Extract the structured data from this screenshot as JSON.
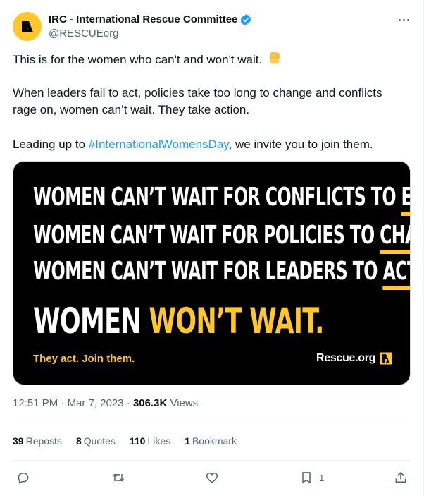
{
  "account": {
    "display_name": "IRC - International Rescue Committee",
    "handle": "@RESCUEorg",
    "verified": true,
    "avatar_color": "#ffc72c"
  },
  "tweet": {
    "line1": "This is for the women who can't and won't wait.",
    "line1_emoji": "raised-fist-emoji",
    "paragraph2": "When leaders fail to act, policies take too long to change and conflicts rage on, women can’t wait. They take action.",
    "line3_before": "Leading up to ",
    "hashtag": "#InternationalWomensDay",
    "line3_after": ", we invite you to join them."
  },
  "media": {
    "line1_main": "WOMEN CAN’T WAIT FOR CONFLICTS TO ",
    "line1_underlined": "END.",
    "line2_main": "WOMEN CAN’T WAIT FOR POLICIES TO ",
    "line2_underlined": "CHANGE.",
    "line3_main": "WOMEN CAN’T WAIT FOR LEADERS TO ",
    "line3_underlined": "ACT.",
    "big_white": "WOMEN ",
    "big_yellow": "WON’T WAIT.",
    "tagline": "They act. Join them.",
    "site": "Rescue.org",
    "accent_color": "#ffc72c"
  },
  "meta": {
    "time": "12:51 PM",
    "separator1": " · ",
    "date": "Mar 7, 2023",
    "separator2": " · ",
    "views_count": "306.3K",
    "views_label": " Views"
  },
  "stats": [
    {
      "count": "39",
      "label": "Reposts"
    },
    {
      "count": "8",
      "label": "Quotes"
    },
    {
      "count": "110",
      "label": "Likes"
    },
    {
      "count": "1",
      "label": "Bookmark"
    }
  ],
  "actions": {
    "reply_icon": "reply-icon",
    "repost_icon": "repost-icon",
    "like_icon": "like-icon",
    "bookmark_icon": "bookmark-icon",
    "bookmark_count": "1",
    "share_icon": "share-icon"
  },
  "colors": {
    "link": "#1d9bf0",
    "secondary_text": "#536471",
    "verified_badge": "#1d9bf0"
  }
}
